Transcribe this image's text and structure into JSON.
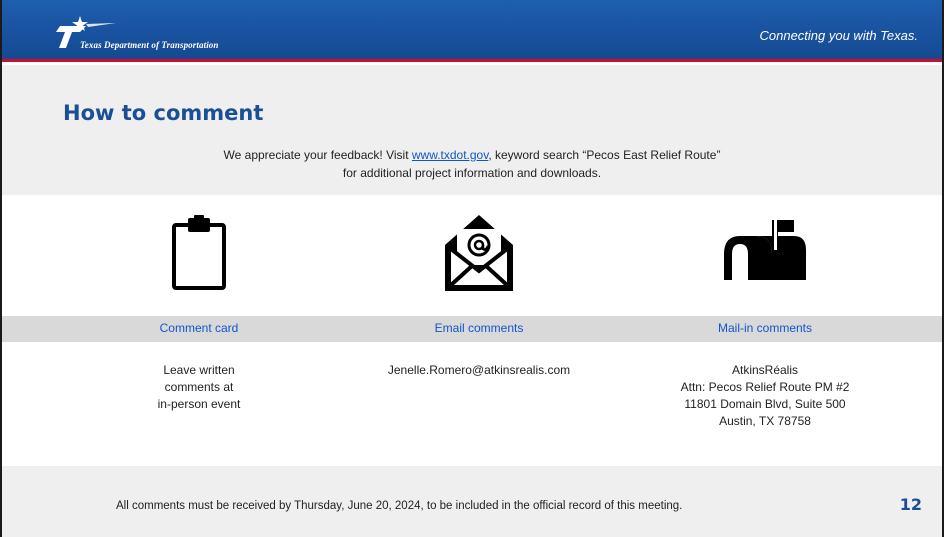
{
  "header": {
    "agency_name": "Texas Department of Transportation",
    "tagline": "Connecting you with Texas."
  },
  "title": "How to comment",
  "intro": {
    "line1_prefix": "We appreciate your feedback! Visit ",
    "link_text": "www.txdot.gov",
    "line1_suffix": ", keyword search “Pecos East Relief Route”",
    "line2": "for additional project information and downloads."
  },
  "columns": [
    {
      "icon": "clipboard-icon",
      "label": "Comment card",
      "body": [
        "Leave written",
        "comments at",
        "in-person event"
      ]
    },
    {
      "icon": "email-envelope-icon",
      "label": "Email comments",
      "body": [
        "Jenelle.Romero@atkinsrealis.com"
      ]
    },
    {
      "icon": "mailbox-icon",
      "label": "Mail-in comments",
      "body": [
        "AtkinsRéalis",
        "Attn: Pecos Relief Route PM #2",
        "11801 Domain Blvd, Suite 500",
        "Austin, TX 78758"
      ]
    }
  ],
  "footer": {
    "deadline": "All comments must be received by Thursday, June 20, 2024, to be included in the official record of this meeting.",
    "page_number": "12"
  },
  "colors": {
    "header_blue": "#1a55a3",
    "accent_red": "#c8102e",
    "title_blue": "#1a4e95",
    "link_blue": "#1155cc",
    "band_gray": "#efefef",
    "label_gray": "#d9d9d9"
  }
}
